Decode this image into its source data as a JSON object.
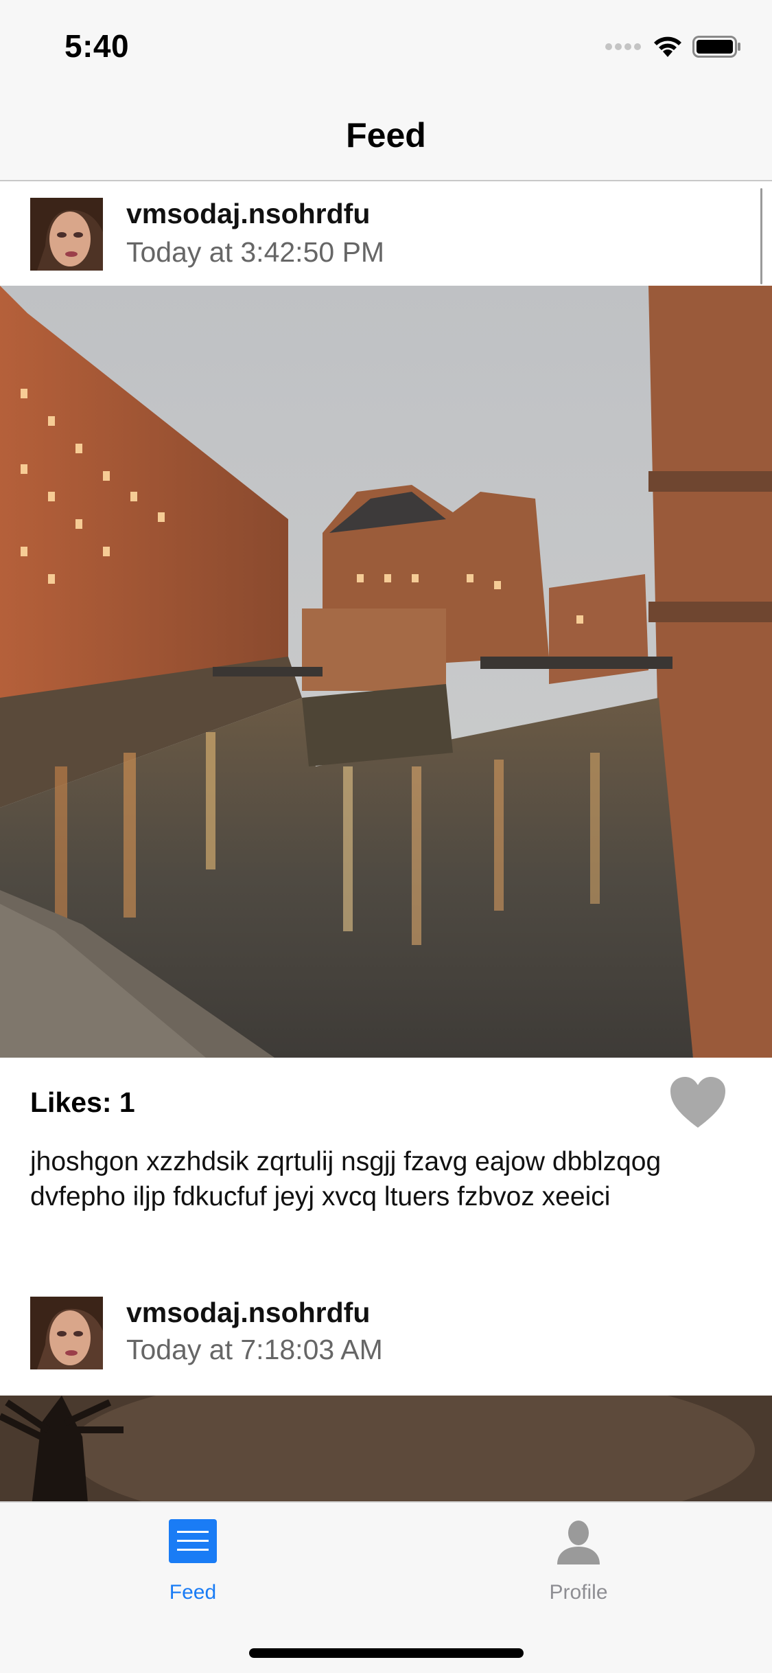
{
  "status_bar": {
    "time": "5:40",
    "icons": [
      "signal-dots-icon",
      "wifi-icon",
      "battery-icon"
    ]
  },
  "nav": {
    "title": "Feed"
  },
  "posts": [
    {
      "username": "vmsodaj.nsohrdfu",
      "timestamp": "Today at 3:42:50 PM",
      "photo_alt": "canal-at-night-photo",
      "likes": "Likes: 1",
      "liked": false,
      "caption": "jhoshgon xzzhdsik zqrtulij nsgjj fzavg eajow dbblzqog dvfepho iljp fdkucfuf jeyj xvcq ltuers fzbvoz xeeici"
    },
    {
      "username": "vmsodaj.nsohrdfu",
      "timestamp": "Today at 7:18:03 AM",
      "photo_alt": "palm-tree-photo"
    }
  ],
  "tabs": [
    {
      "label": "Feed",
      "icon": "feed-list-icon",
      "selected": true
    },
    {
      "label": "Profile",
      "icon": "profile-person-icon",
      "selected": false
    }
  ],
  "colors": {
    "accent": "#1a7cf5",
    "inactive": "#8e8e93",
    "heart": "#a9a9a9",
    "bar_bg": "#f7f7f7"
  }
}
